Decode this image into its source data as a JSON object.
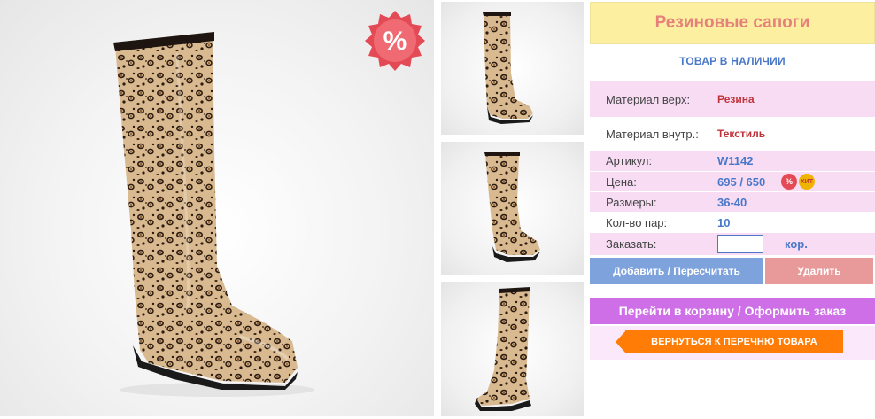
{
  "sale_badge": {
    "symbol": "%",
    "color": "#e44a55"
  },
  "product": {
    "title": "Резиновые сапоги",
    "stock_status": "ТОВАР В НАЛИЧИИ"
  },
  "specs": {
    "material_top_label": "Материал верх:",
    "material_top_value": "Резина",
    "material_inner_label": "Материал внутр.:",
    "material_inner_value": "Текстиль",
    "article_label": "Артикул:",
    "article_value": "W1142",
    "price_label": "Цена:",
    "price_old": "695",
    "price_separator": " / ",
    "price_new": "650",
    "sizes_label": "Размеры:",
    "sizes_value": "36-40",
    "pairs_label": "Кол-во пар:",
    "pairs_value": "10",
    "order_label": "Заказать:",
    "order_unit": "кор."
  },
  "badges": {
    "discount": "%",
    "hit": "ХИТ"
  },
  "order_input": {
    "value": "",
    "placeholder": ""
  },
  "buttons": {
    "add_recalc": "Добавить / Пересчитать",
    "delete": "Удалить",
    "go_to_cart": "Перейти в корзину / Оформить заказ",
    "back_to_list": "ВЕРНУТЬСЯ К ПЕРЕЧНЮ ТОВАРА"
  },
  "colors": {
    "title_bg": "#fcf0a0",
    "title_text": "#e6807a",
    "row_pink": "#f7dcf4",
    "accent_blue": "#4a78c8",
    "accent_red": "#c0333a",
    "add_button": "#7ea2dc",
    "delete_button": "#e89a9a",
    "cart_button": "#cf6fe8",
    "back_button": "#ff7d06"
  },
  "gallery": {
    "main_image": "leopard-print-rubber-boot",
    "thumbnails": [
      "boot-side-view",
      "boot-front-view",
      "boot-angled-view"
    ]
  }
}
